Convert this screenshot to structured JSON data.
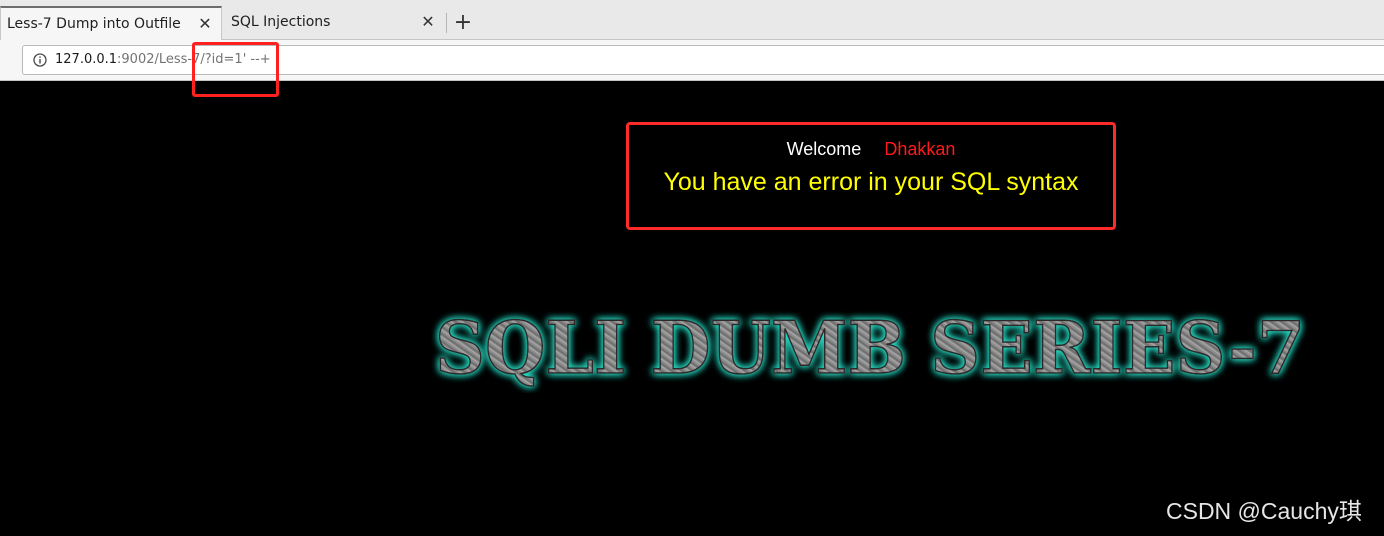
{
  "tabs": [
    {
      "title": "Less-7 Dump into Outfile",
      "active": true
    },
    {
      "title": "SQL Injections",
      "active": false
    }
  ],
  "tab_close_glyph": "✕",
  "new_tab_glyph": "+",
  "address_bar": {
    "url_host": "127.0.0.1",
    "url_rest": ":9002/Less-7/?id=1' --+",
    "info_icon": "info-icon"
  },
  "page": {
    "welcome_label": "Welcome",
    "welcome_name": "Dhakkan",
    "error_message": "You have an error in your SQL syntax",
    "banner_text": "SQLI DUMB SERIES-7",
    "watermark": "CSDN @Cauchy琪"
  },
  "colors": {
    "page_background": "#000000",
    "welcome_label": "#ffffff",
    "welcome_name": "#ff1a1a",
    "error_message": "#ffff00",
    "highlight_box": "#ff2020",
    "banner_glow": "#27e0c8",
    "banner_fill": "#8a8a8a"
  }
}
